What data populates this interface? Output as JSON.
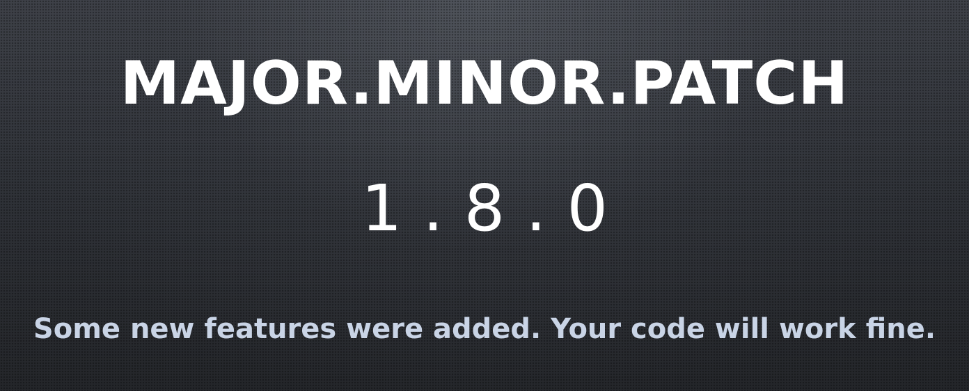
{
  "slide": {
    "title": "MAJOR.MINOR.PATCH",
    "version": "1.8.0",
    "caption": "Some new features were added. Your code will work fine."
  },
  "colors": {
    "background": "#2b2e33",
    "title_text": "#ffffff",
    "caption_text": "#c9d4e6"
  }
}
